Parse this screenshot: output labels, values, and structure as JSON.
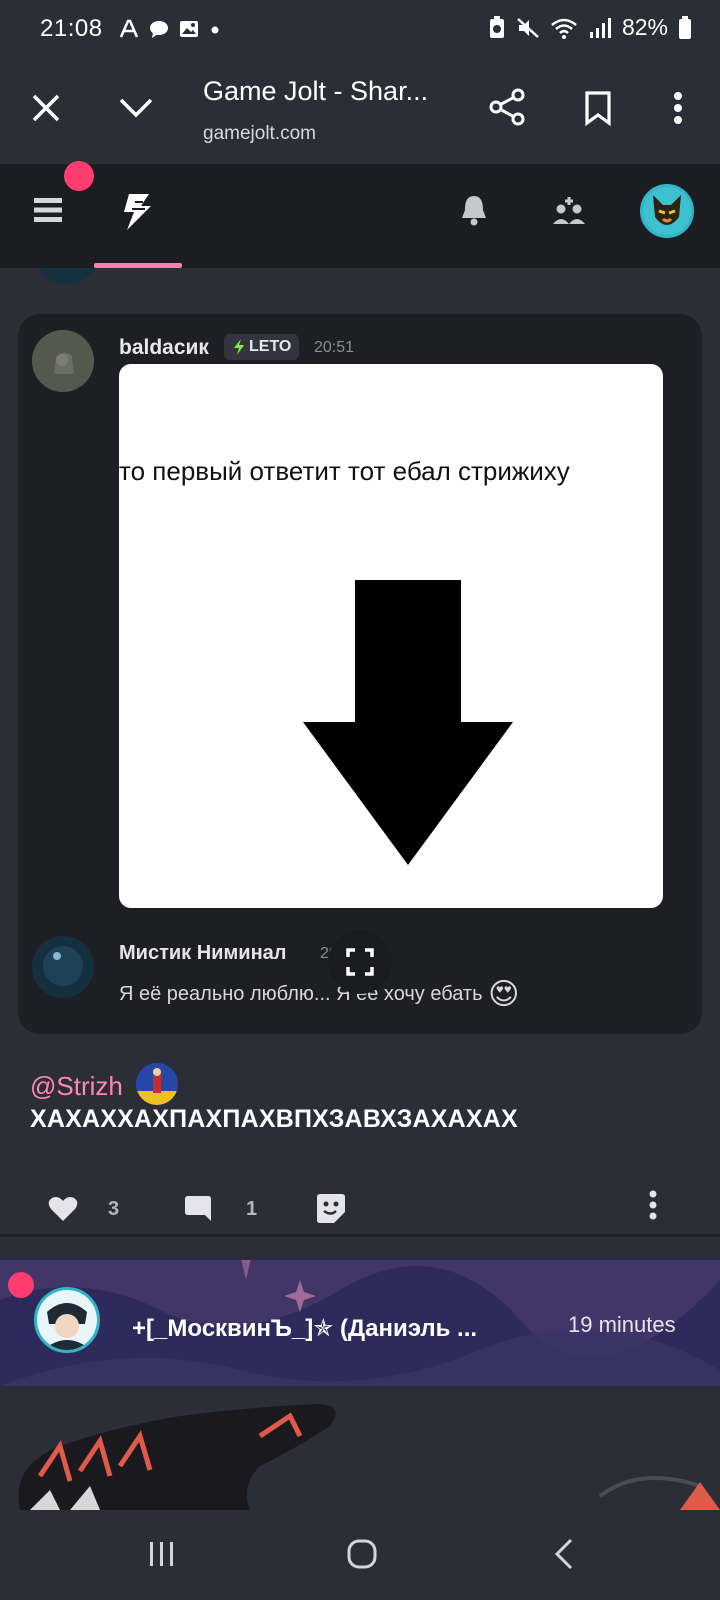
{
  "status_bar": {
    "time": "21:08",
    "battery": "82%",
    "left_icons": [
      "font-icon",
      "chat-bubble-icon",
      "image-icon",
      "dot-icon"
    ],
    "right_icons": [
      "battery-saver-icon",
      "mute-icon",
      "wifi-icon",
      "signal-icon",
      "battery-icon"
    ]
  },
  "browser": {
    "title": "Game Jolt - Shar...",
    "url": "gamejolt.com"
  },
  "feed": {
    "quoted": {
      "username": "baldacик",
      "badge": "LETO",
      "time": "20:51",
      "image_text": "то первый ответит тот ебал  стрижиху",
      "reply": {
        "username": "Мистик Ниминал",
        "time": "20:",
        "text": "Я её реально люблю... Я её хочу ебать",
        "emoji": "😍"
      }
    },
    "post": {
      "mention": "@Strizh",
      "text": "ХАХАХХАХПАХПАХВПХЗАВХЗАХАХАХ",
      "likes": "3",
      "comments": "1"
    },
    "next_post": {
      "author": "+[_МосквинЪ_]✯ (Даниэль ...",
      "time": "19 minutes"
    }
  },
  "colors": {
    "background": "#2b2d37",
    "nav_background": "#1c1d23",
    "card_background": "#1e1f25",
    "accent_pink": "#ff7fb0",
    "notification_red": "#ff3d6e"
  }
}
